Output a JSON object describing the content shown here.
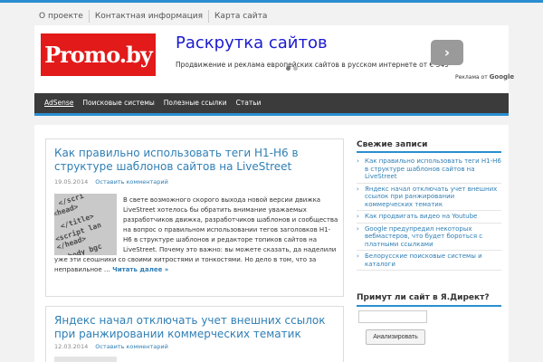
{
  "top_nav": {
    "items": [
      "О проекте",
      "Контактная информация",
      "Карта сайта"
    ]
  },
  "logo": {
    "text": "Promo.by"
  },
  "ad": {
    "title": "Раскрутка сайтов",
    "description": "Продвижение и реклама европейских сайтов в русском интернете от € 549",
    "next_button": "›",
    "by_label": "Реклама от",
    "by_brand": "Google"
  },
  "main_nav": {
    "items": [
      "AdSense",
      "Поисковые системы",
      "Полезные ссылки",
      "Статьи"
    ]
  },
  "posts": [
    {
      "title": "Как правильно использовать теги H1-H6 в структуре шаблонов сайтов на LiveStreet",
      "date": "19.05.2014",
      "comment_link": "Оставить комментарий",
      "excerpt": "В свете возможного скорого выхода новой версии движка LiveStreet хотелось бы обратить внимание уважаемых разработчиков движка, разработчиков шаблонов и сообщества на вопрос о правильном использовании тегов заголовков H1-H6 в структуре шаблонов и редакторе топиков сайтов на LiveStreet. Почему это важно: вы можете сказать, да наделили уже эти сеошники со своими хитростями и тонкостями. Но дело в том, что за неправильное …",
      "read_more": "Читать далее »",
      "image_tags": [
        "</scri",
        "<head>",
        "</title>",
        "<script lan",
        "</head>",
        "<body bgc"
      ]
    },
    {
      "title": "Яндекс начал отключать учет внешних ссылок при ранжировании коммерческих тематик",
      "date": "12.03.2014",
      "comment_link": "Оставить комментарий"
    }
  ],
  "sidebar": {
    "recent_title": "Свежие записи",
    "recent_items": [
      "Как правильно использовать теги H1-H6 в структуре шаблонов сайтов на LiveStreet",
      "Яндекс начал отключать учет внешних ссылок при ранжировании коммерческих тематик",
      "Как продвигать видео на Youtube",
      "Google предупредил некоторых вебмастеров, что будет бороться с платными ссылками",
      "Белорусские поисковые системы и каталоги"
    ],
    "yadirect_title": "Примут ли сайт в Я.Директ?",
    "yadirect_input_value": "",
    "yadirect_button": "Анализировать"
  },
  "colors": {
    "accent": "#2a8fd0",
    "link": "#2f7fb5",
    "logo_bg": "#e21a1a",
    "nav_bg": "#3b3b3b"
  }
}
